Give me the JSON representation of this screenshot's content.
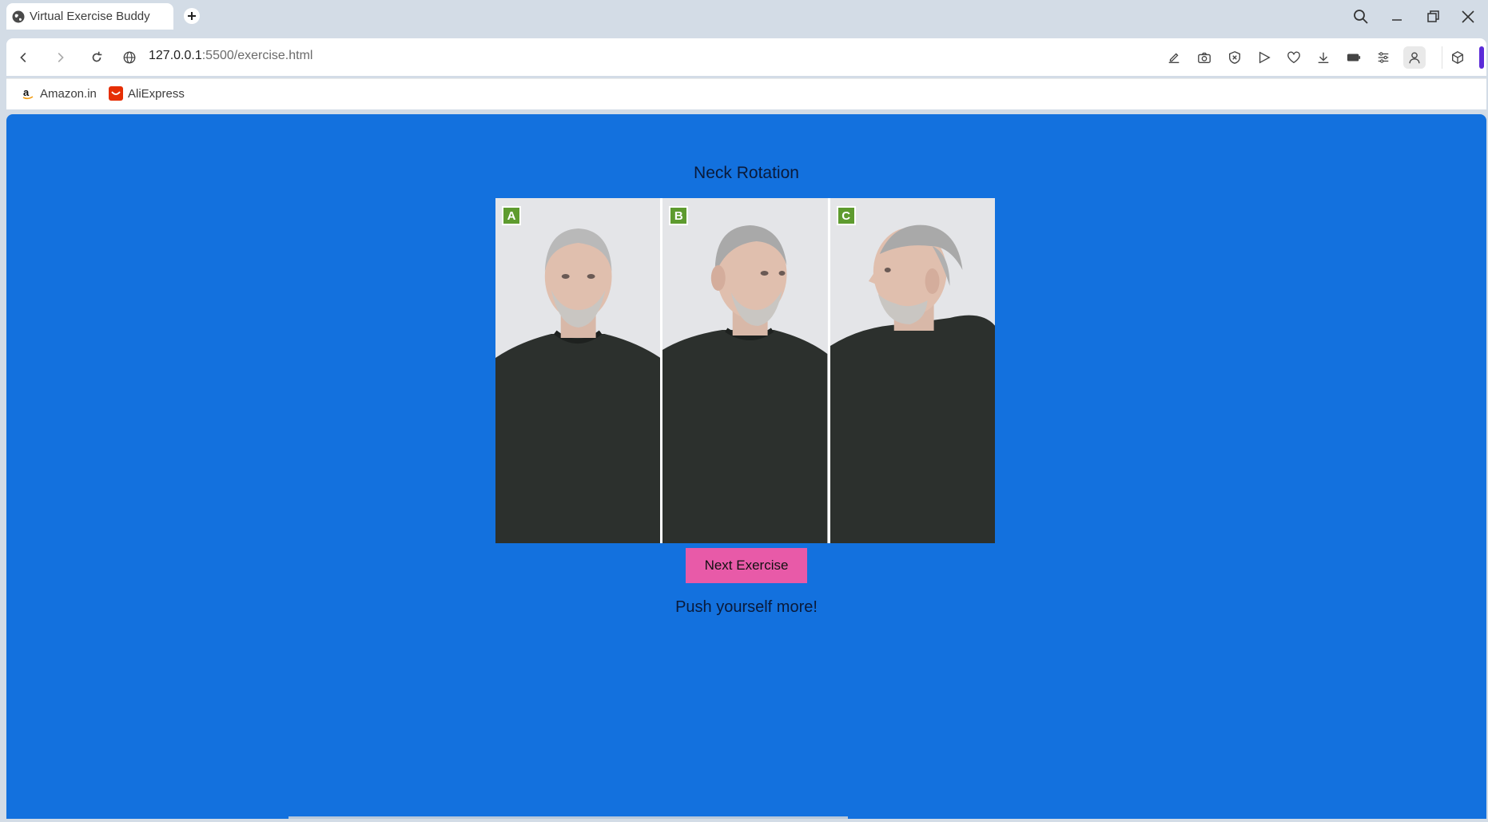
{
  "browser": {
    "tab_title": "Virtual Exercise Buddy",
    "url_host": "127.0.0.1",
    "url_path": ":5500/exercise.html",
    "bookmarks": [
      {
        "label": "Amazon.in",
        "icon": "amazon-icon"
      },
      {
        "label": "AliExpress",
        "icon": "aliexpress-icon"
      }
    ],
    "toolbar_icons": [
      "edit-icon",
      "camera-icon",
      "shield-icon",
      "play-icon",
      "heart-icon",
      "download-icon",
      "battery-icon",
      "settings-icon",
      "profile-icon",
      "extensions-icon"
    ]
  },
  "page": {
    "title": "Neck Rotation",
    "images": [
      {
        "label": "A"
      },
      {
        "label": "B"
      },
      {
        "label": "C"
      }
    ],
    "next_button": "Next Exercise",
    "message": "Push yourself more!"
  },
  "colors": {
    "page_background": "#1371de",
    "button_background": "#e85aa8",
    "label_background": "#5e9b2f"
  }
}
